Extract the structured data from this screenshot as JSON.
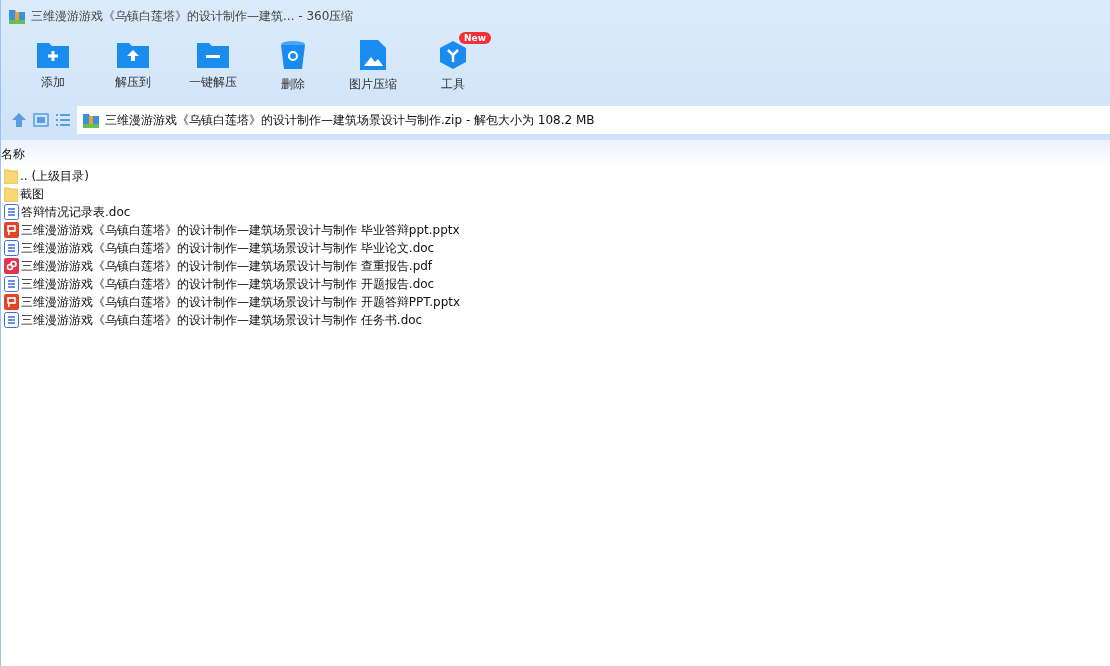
{
  "window": {
    "title": "三维漫游游戏《乌镇白莲塔》的设计制作—建筑... - 360压缩"
  },
  "toolbar": [
    {
      "kind": "add",
      "label": "添加"
    },
    {
      "kind": "extract",
      "label": "解压到"
    },
    {
      "kind": "oneclick",
      "label": "一键解压"
    },
    {
      "kind": "delete",
      "label": "删除"
    },
    {
      "kind": "image",
      "label": "图片压缩"
    },
    {
      "kind": "tools",
      "label": "工具",
      "badge": "New"
    }
  ],
  "address": {
    "text": "三维漫游游戏《乌镇白莲塔》的设计制作—建筑场景设计与制作.zip - 解包大小为 108.2 MB"
  },
  "list": {
    "column": "名称",
    "rows": [
      {
        "kind": "folder",
        "name": ".. (上级目录)"
      },
      {
        "kind": "folder",
        "name": "截图"
      },
      {
        "kind": "word",
        "name": "答辩情况记录表.doc"
      },
      {
        "kind": "ppt",
        "name": "三维漫游游戏《乌镇白莲塔》的设计制作—建筑场景设计与制作 毕业答辩ppt.pptx"
      },
      {
        "kind": "word",
        "name": "三维漫游游戏《乌镇白莲塔》的设计制作—建筑场景设计与制作 毕业论文.doc"
      },
      {
        "kind": "pdf",
        "name": "三维漫游游戏《乌镇白莲塔》的设计制作—建筑场景设计与制作 查重报告.pdf"
      },
      {
        "kind": "word",
        "name": "三维漫游游戏《乌镇白莲塔》的设计制作—建筑场景设计与制作 开题报告.doc"
      },
      {
        "kind": "ppt",
        "name": "三维漫游游戏《乌镇白莲塔》的设计制作—建筑场景设计与制作 开题答辩PPT.pptx"
      },
      {
        "kind": "word",
        "name": "三维漫游游戏《乌镇白莲塔》的设计制作—建筑场景设计与制作 任务书.doc"
      }
    ]
  }
}
